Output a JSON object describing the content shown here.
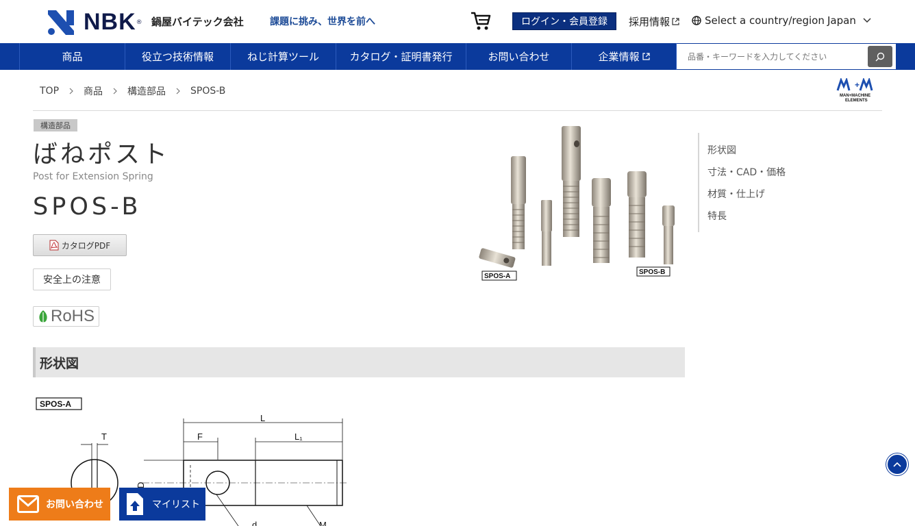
{
  "header": {
    "logo_text": "NBK",
    "logo_reg": "®",
    "company_name": "鍋屋バイテック会社",
    "slogan": "課題に挑み、世界を前へ",
    "login_label": "ログイン・会員登録",
    "recruit_label": "採用情報",
    "country_label": "Select a country/region",
    "country_value": "Japan"
  },
  "nav": {
    "items": [
      {
        "label": "商品"
      },
      {
        "label": "役立つ技術情報"
      },
      {
        "label": "ねじ計算ツール"
      },
      {
        "label": "カタログ・証明書発行"
      },
      {
        "label": "お問い合わせ"
      },
      {
        "label": "企業情報"
      }
    ],
    "search_placeholder": "品番・キーワードを入力してください"
  },
  "breadcrumb": [
    "TOP",
    "商品",
    "構造部品",
    "SPOS-B"
  ],
  "brand_logo_text": "MAN+MACHINE ELEMENTS",
  "product": {
    "category": "構造部品",
    "title": "ばねポスト",
    "subtitle": "Post for Extension Spring",
    "code": "SPOS-B",
    "pdf_label": "カタログPDF",
    "safety_label": "安全上の注意",
    "rohs_label": "RoHS",
    "image_labels": [
      "SPOS-A",
      "SPOS-B"
    ]
  },
  "side_menu": [
    "形状図",
    "寸法・CAD・価格",
    "材質・仕上げ",
    "特長"
  ],
  "section": {
    "title": "形状図",
    "drawing_label": "SPOS-A",
    "dims": [
      "T",
      "L",
      "F",
      "L₁",
      "D",
      "d",
      "M"
    ]
  },
  "floating": {
    "contact_label": "お問い合わせ",
    "mylist_label": "マイリスト"
  },
  "colors": {
    "nav_blue": "#0b3a9c",
    "login_blue": "#0b2f7f",
    "contact_orange": "#ee7c19",
    "slogan_blue": "#1d4b97"
  }
}
